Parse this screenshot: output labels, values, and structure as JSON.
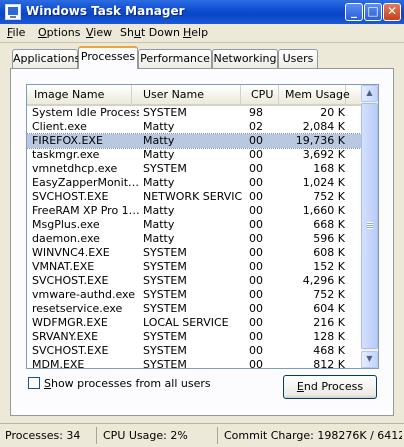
{
  "window": {
    "title": "Windows Task Manager"
  },
  "title_buttons": {
    "minimize": "_",
    "maximize": "□",
    "close": "✕"
  },
  "menu": [
    {
      "first": "F",
      "rest": "ile"
    },
    {
      "first": "O",
      "rest": "ptions"
    },
    {
      "first": "V",
      "rest": "iew"
    },
    {
      "pre": "Sh",
      "first": "u",
      "rest": "t Down"
    },
    {
      "first": "H",
      "rest": "elp"
    }
  ],
  "tabs": [
    "Applications",
    "Processes",
    "Performance",
    "Networking",
    "Users"
  ],
  "active_tab": "Processes",
  "columns": [
    "Image Name",
    "User Name",
    "CPU",
    "Mem Usage"
  ],
  "processes": [
    {
      "name": "System Idle Process",
      "user": "SYSTEM",
      "cpu": "98",
      "mem": "20 K"
    },
    {
      "name": "Client.exe",
      "user": "Matty",
      "cpu": "02",
      "mem": "2,084 K"
    },
    {
      "name": "FIREFOX.EXE",
      "user": "Matty",
      "cpu": "00",
      "mem": "19,736 K",
      "selected": true
    },
    {
      "name": "taskmgr.exe",
      "user": "Matty",
      "cpu": "00",
      "mem": "3,692 K"
    },
    {
      "name": "vmnetdhcp.exe",
      "user": "SYSTEM",
      "cpu": "00",
      "mem": "168 K"
    },
    {
      "name": "EasyZapperMonit…",
      "user": "Matty",
      "cpu": "00",
      "mem": "1,024 K"
    },
    {
      "name": "SVCHOST.EXE",
      "user": "NETWORK SERVICE",
      "cpu": "00",
      "mem": "752 K"
    },
    {
      "name": "FreeRAM XP Pro 1…",
      "user": "Matty",
      "cpu": "00",
      "mem": "1,660 K"
    },
    {
      "name": "MsgPlus.exe",
      "user": "Matty",
      "cpu": "00",
      "mem": "668 K"
    },
    {
      "name": "daemon.exe",
      "user": "Matty",
      "cpu": "00",
      "mem": "596 K"
    },
    {
      "name": "WINVNC4.EXE",
      "user": "SYSTEM",
      "cpu": "00",
      "mem": "608 K"
    },
    {
      "name": "VMNAT.EXE",
      "user": "SYSTEM",
      "cpu": "00",
      "mem": "152 K"
    },
    {
      "name": "SVCHOST.EXE",
      "user": "SYSTEM",
      "cpu": "00",
      "mem": "4,296 K"
    },
    {
      "name": "vmware-authd.exe",
      "user": "SYSTEM",
      "cpu": "00",
      "mem": "752 K"
    },
    {
      "name": "resetservice.exe",
      "user": "SYSTEM",
      "cpu": "00",
      "mem": "604 K"
    },
    {
      "name": "WDFMGR.EXE",
      "user": "LOCAL SERVICE",
      "cpu": "00",
      "mem": "216 K"
    },
    {
      "name": "SRVANY.EXE",
      "user": "SYSTEM",
      "cpu": "00",
      "mem": "128 K"
    },
    {
      "name": "SVCHOST.EXE",
      "user": "SYSTEM",
      "cpu": "00",
      "mem": "468 K"
    },
    {
      "name": "MDM.EXE",
      "user": "SYSTEM",
      "cpu": "00",
      "mem": "812 K"
    }
  ],
  "show_all": {
    "first": "S",
    "rest": "how processes from all users",
    "checked": false
  },
  "end_button": {
    "first": "E",
    "rest": "nd Process"
  },
  "status": {
    "processes": "Processes: 34",
    "cpu": "CPU Usage: 2%",
    "commit": "Commit Charge: 198276K / 6412"
  },
  "colors": {
    "titlebar": "#0A46C4",
    "selection": "#B8C8E0",
    "tab_accent": "#F0A43C",
    "face": "#ECE9D8"
  }
}
